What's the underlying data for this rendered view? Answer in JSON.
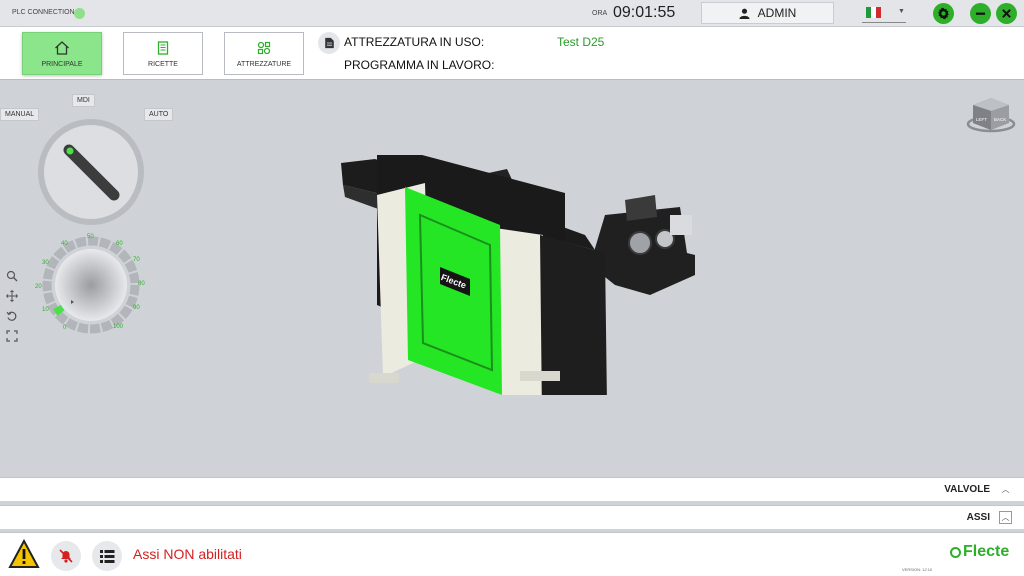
{
  "topbar": {
    "plc_label": "PLC CONNECTION",
    "time_label": "ORA",
    "time": "09:01:55",
    "user": "ADMIN",
    "language_flag_colors": [
      "#1e9a3c",
      "#ffffff",
      "#d22b2b"
    ],
    "settings_icon": "gear-icon",
    "minimize_icon": "minus-icon",
    "close_icon": "close-icon"
  },
  "toolbar": {
    "nav": [
      {
        "label": "PRINCIPALE",
        "icon": "home-icon",
        "active": true
      },
      {
        "label": "RICETTE",
        "icon": "recipe-icon",
        "active": false
      },
      {
        "label": "ATTREZZATURE",
        "icon": "tooling-icon",
        "active": false
      }
    ],
    "tooling_in_use_label": "ATTREZZATURA IN USO:",
    "tooling_in_use_value": "Test D25",
    "program_label": "PROGRAMMA IN LAVORO:",
    "program_value": ""
  },
  "viewport": {
    "mode_manual": "MANUAL",
    "mode_mdi": "MDI",
    "mode_auto": "AUTO",
    "override_ticks": [
      "0",
      "10",
      "20",
      "30",
      "40",
      "50",
      "60",
      "70",
      "80",
      "90",
      "100"
    ],
    "machine_logo": "Flecte",
    "view_cube_labels": [
      "LEFT",
      "BACK"
    ],
    "tool_icons": [
      "zoom-icon",
      "pan-icon",
      "rotate-icon",
      "fit-icon"
    ]
  },
  "panels": {
    "valves_label": "VALVOLE",
    "axes_label": "ASSI"
  },
  "footer": {
    "status_message": "Assi NON abilitati",
    "brand": "Flecte",
    "version": "VERSION: 12.10"
  },
  "colors": {
    "accent_green": "#2eaf2a",
    "active_tab": "#8be58a",
    "machine_green": "#25e625",
    "alert_red": "#d42020",
    "warning_yellow": "#f5c400"
  }
}
